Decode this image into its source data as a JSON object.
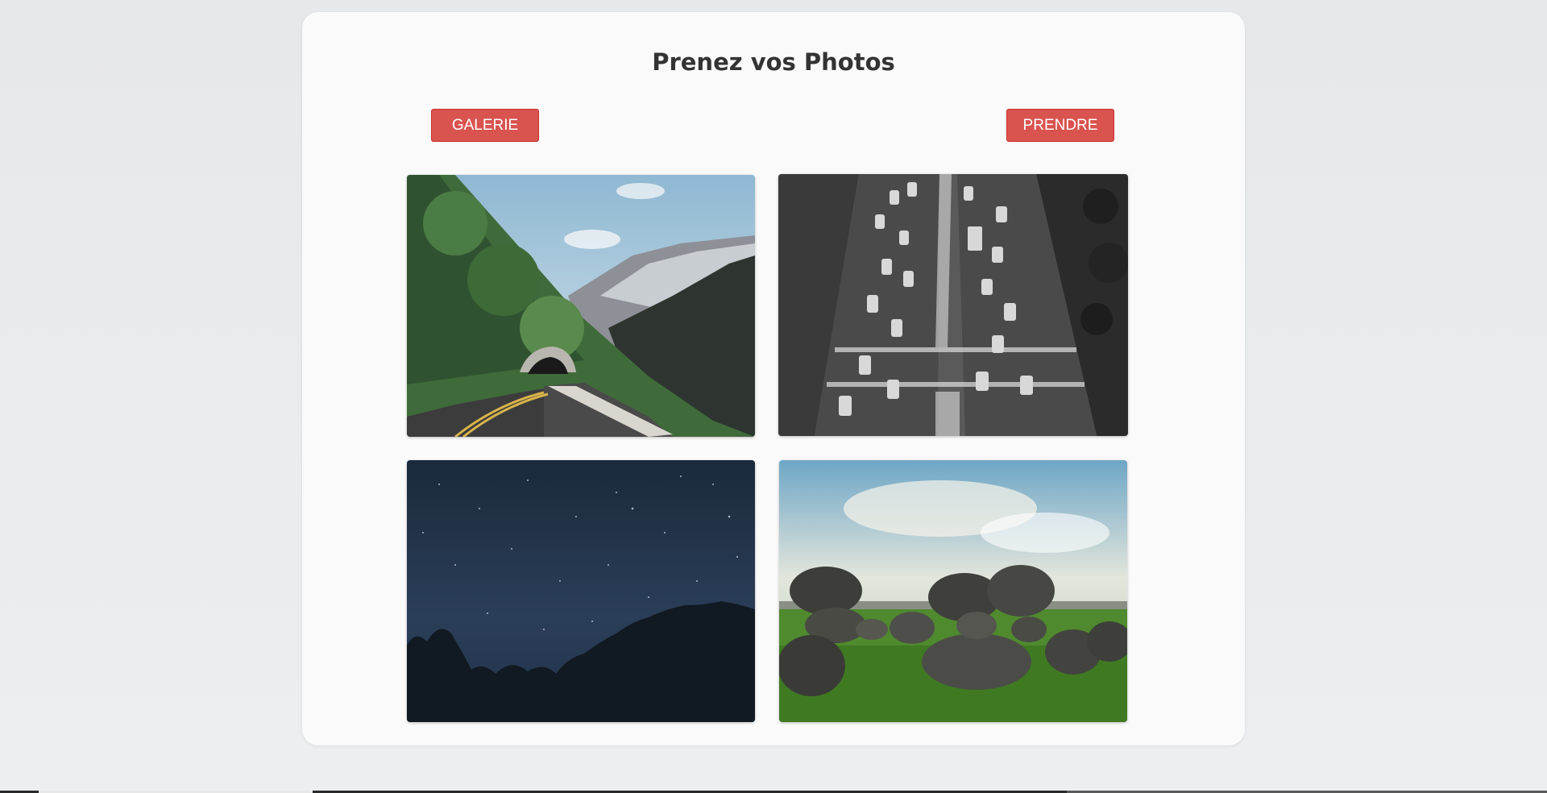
{
  "page": {
    "title": "Prenez vos Photos"
  },
  "buttons": {
    "gallery_label": "GALERIE",
    "take_label": "PRENDRE"
  },
  "colors": {
    "button_red": "#d9534f",
    "card_background": "#fafafa",
    "page_background": "#e9eaec"
  },
  "photos": [
    {
      "subject": "mountain-road-tunnel"
    },
    {
      "subject": "black-white-traffic-avenue"
    },
    {
      "subject": "night-starry-sky-trees"
    },
    {
      "subject": "boulders-on-grass"
    }
  ]
}
